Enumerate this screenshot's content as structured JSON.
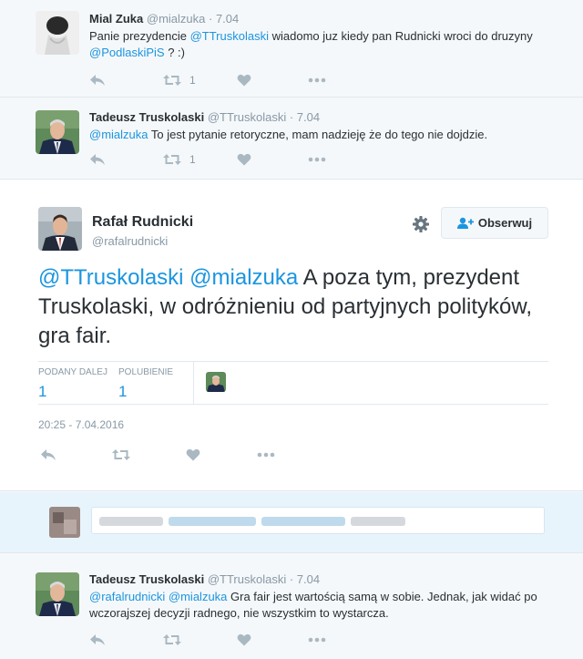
{
  "tweets": [
    {
      "name": "Mial Zuka",
      "handle": "@mialzuka",
      "time": "· 7.04",
      "text_parts": [
        "Panie prezydencie ",
        "@TTruskolaski",
        " wiadomo juz kiedy pan Rudnicki wroci do druzyny ",
        "@PodlaskiPiS",
        " ? :)"
      ],
      "retweets": "1"
    },
    {
      "name": "Tadeusz Truskolaski",
      "handle": "@TTruskolaski",
      "time": "· 7.04",
      "text_parts": [
        "@mialzuka",
        " To jest pytanie retoryczne, mam nadzieję że do tego nie dojdzie."
      ],
      "retweets": "1"
    },
    {
      "name": "Tadeusz Truskolaski",
      "handle": "@TTruskolaski",
      "time": "· 7.04",
      "text_parts": [
        "@rafalrudnicki",
        " ",
        "@mialzuka",
        " Gra fair jest wartością samą w sobie. Jednak, jak widać po wczorajszej decyzji radnego, nie wszystkim to wystarcza."
      ]
    }
  ],
  "main_tweet": {
    "name": "Rafał Rudnicki",
    "handle": "@rafalrudnicki",
    "follow_label": "Obserwuj",
    "text_parts": [
      "@TTruskolaski",
      " ",
      "@mialzuka",
      " A poza tym, prezydent Truskolaski, w odróżnieniu od partyjnych polityków, gra fair."
    ],
    "retweets_label": "PODANY DALEJ",
    "retweets_value": "1",
    "likes_label": "POLUBIENIE",
    "likes_value": "1",
    "timestamp": "20:25 - 7.04.2016"
  },
  "icons": [
    "reply-icon",
    "retweet-icon",
    "heart-icon",
    "more-icon",
    "gear-icon",
    "follow-person-icon"
  ],
  "colors": {
    "mention": "#1b95e0",
    "muted": "#8899a6",
    "icon": "#aab8c2",
    "background": "#f5f8fa",
    "reply_box": "#e8f4fb"
  }
}
